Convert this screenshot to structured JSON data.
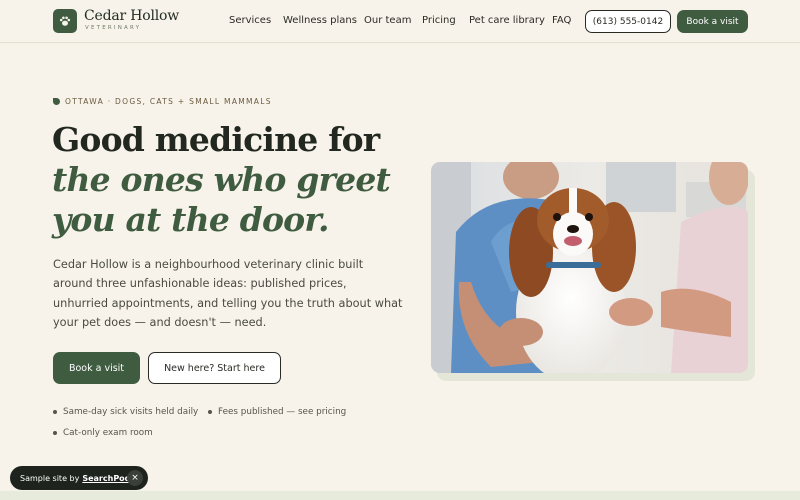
{
  "brand": {
    "name": "Cedar Hollow",
    "sub": "VETERINARY",
    "logo_icon": "paw-icon",
    "accent_color": "#3f5b40"
  },
  "nav": {
    "items": [
      {
        "label": "Services"
      },
      {
        "label": "Wellness plans"
      },
      {
        "label": "Our team"
      },
      {
        "label": "Pricing"
      },
      {
        "label": "Pet care library"
      },
      {
        "label": "FAQ"
      }
    ],
    "phone": "(613) 555-0142",
    "book": "Book a visit"
  },
  "hero": {
    "eyebrow": "OTTAWA · DOGS, CATS + SMALL MAMMALS",
    "headline_1": "Good medicine for",
    "headline_2": "the ones who greet",
    "headline_3": "you at the door.",
    "lede": "Cedar Hollow is a neighbourhood veterinary clinic built around three unfashionable ideas: published prices, unhurried appointments, and telling you the truth about what your pet does — and doesn't — need.",
    "cta_primary": "Book a visit",
    "cta_secondary": "New here? Start here",
    "features": [
      "Same-day sick visits held daily",
      "Fees published — see pricing",
      "Cat-only exam room"
    ]
  },
  "toast": {
    "prefix": "Sample site by",
    "brand": "SearchPod",
    "close": "×"
  }
}
